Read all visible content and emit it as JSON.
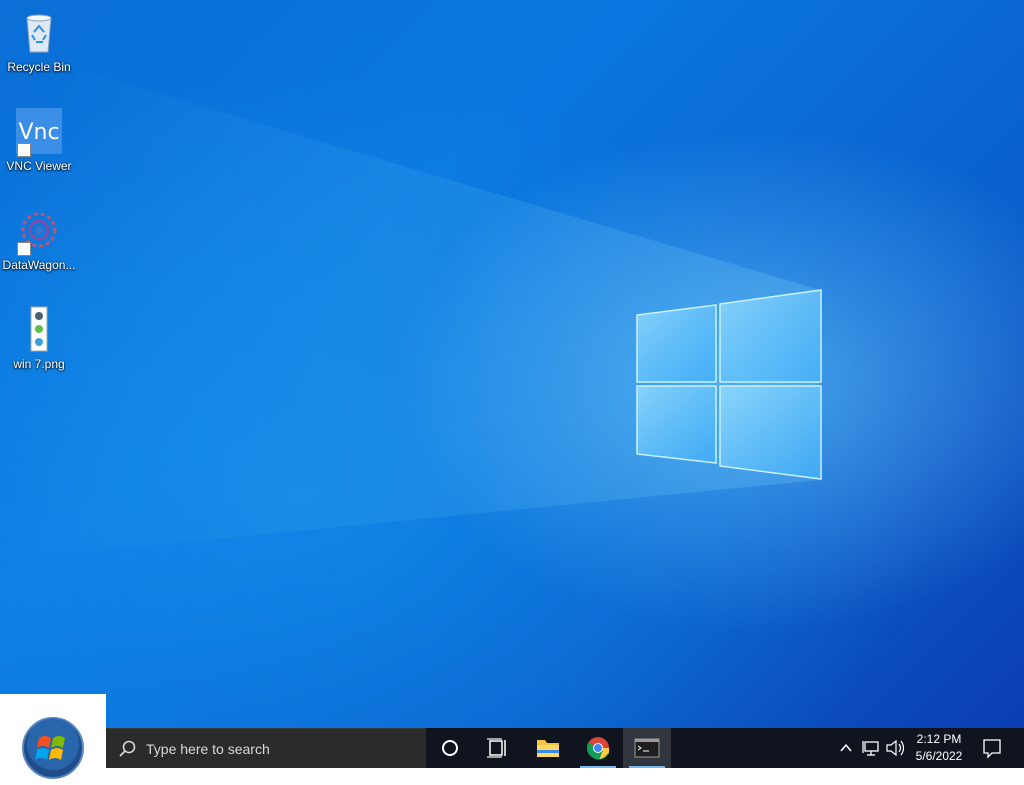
{
  "desktop": {
    "icons": [
      {
        "label": "Recycle Bin",
        "icon": "recycle-bin-icon"
      },
      {
        "label": "VNC Viewer",
        "icon": "vnc-viewer-icon"
      },
      {
        "label": "DataWagon...",
        "icon": "datawagon-icon"
      },
      {
        "label": "win 7.png",
        "icon": "image-file-icon"
      }
    ]
  },
  "taskbar": {
    "search_placeholder": "Type here to search",
    "pinned": [
      {
        "name": "cortana",
        "icon": "cortana-circle-icon"
      },
      {
        "name": "task-view",
        "icon": "task-view-icon"
      },
      {
        "name": "file-explorer",
        "icon": "folder-icon"
      },
      {
        "name": "chrome",
        "icon": "chrome-icon"
      },
      {
        "name": "terminal",
        "icon": "terminal-icon",
        "active": true
      }
    ],
    "tray": {
      "time": "2:12 PM",
      "date": "5/6/2022"
    }
  },
  "colors": {
    "accent": "#76b9ed",
    "taskbar": "#10141f",
    "searchbox": "#2b2b2b"
  }
}
